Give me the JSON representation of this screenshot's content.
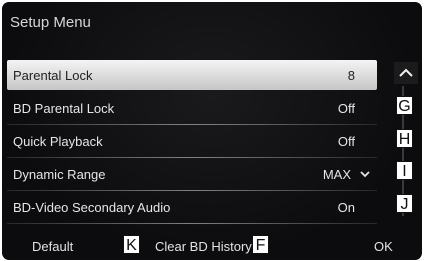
{
  "screen": {
    "title": "Setup Menu",
    "items": [
      {
        "label": "Parental Lock",
        "value": "8",
        "selected": true
      },
      {
        "label": "BD Parental Lock",
        "value": "Off"
      },
      {
        "label": "Quick Playback",
        "value": "Off"
      },
      {
        "label": "Dynamic Range",
        "value": "MAX",
        "has_dropdown": true
      },
      {
        "label": "BD-Video Secondary Audio",
        "value": "On"
      }
    ],
    "footer": {
      "default_label": "Default",
      "clear_label": "Clear BD History",
      "ok_label": "OK"
    },
    "callouts": {
      "g": "G",
      "h": "H",
      "i": "I",
      "j": "J",
      "k": "K",
      "f": "F"
    },
    "icons": {
      "scroll_up": "chevron-up-icon",
      "dropdown": "chevron-down-icon"
    },
    "colors": {
      "background": "#0c0c0f",
      "text": "#e6e6e6",
      "selected_row": "#e6e6e6"
    }
  }
}
